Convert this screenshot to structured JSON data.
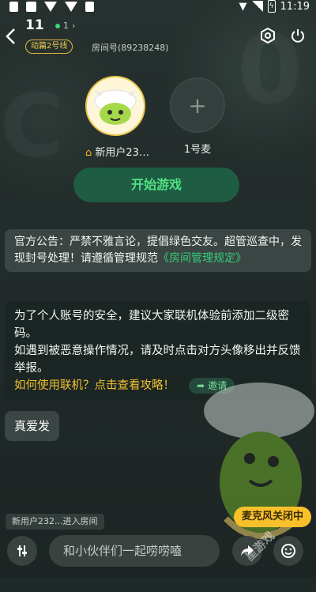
{
  "status_bar": {
    "time": "11:19"
  },
  "header": {
    "room_name": "11",
    "online_count": "1",
    "line_tag": "动篇2号线",
    "room_id": "房间号(89238248)"
  },
  "seats": [
    {
      "name": "新用户23…",
      "host": true
    },
    {
      "name": "1号麦",
      "host": false
    }
  ],
  "start_button": "开始游戏",
  "notice": {
    "text": "官方公告：严禁不雅言论，提倡绿色交友。超管巡查中，发现封号处理！请遵循管理规范",
    "link": "《房间管理规定》"
  },
  "tips": {
    "line1": "为了个人账号的安全，建议大家联机体验前添加二级密码。",
    "line2": "如遇到被恶意操作情况，请及时点击对方头像移出并反馈举报。",
    "link": "如何使用联机？点击查看攻略！",
    "invite": "邀请"
  },
  "message": "真爱发",
  "join_tip": "新用户232...进入房间",
  "mic_toast": "麦克风关闭中",
  "chat": {
    "placeholder": "和小伙伴们一起唠唠嗑"
  },
  "watermark": "星游戏",
  "colors": {
    "accent_green": "#33d07a",
    "gold": "#f1c331",
    "start_bg": "#1e5c43"
  }
}
